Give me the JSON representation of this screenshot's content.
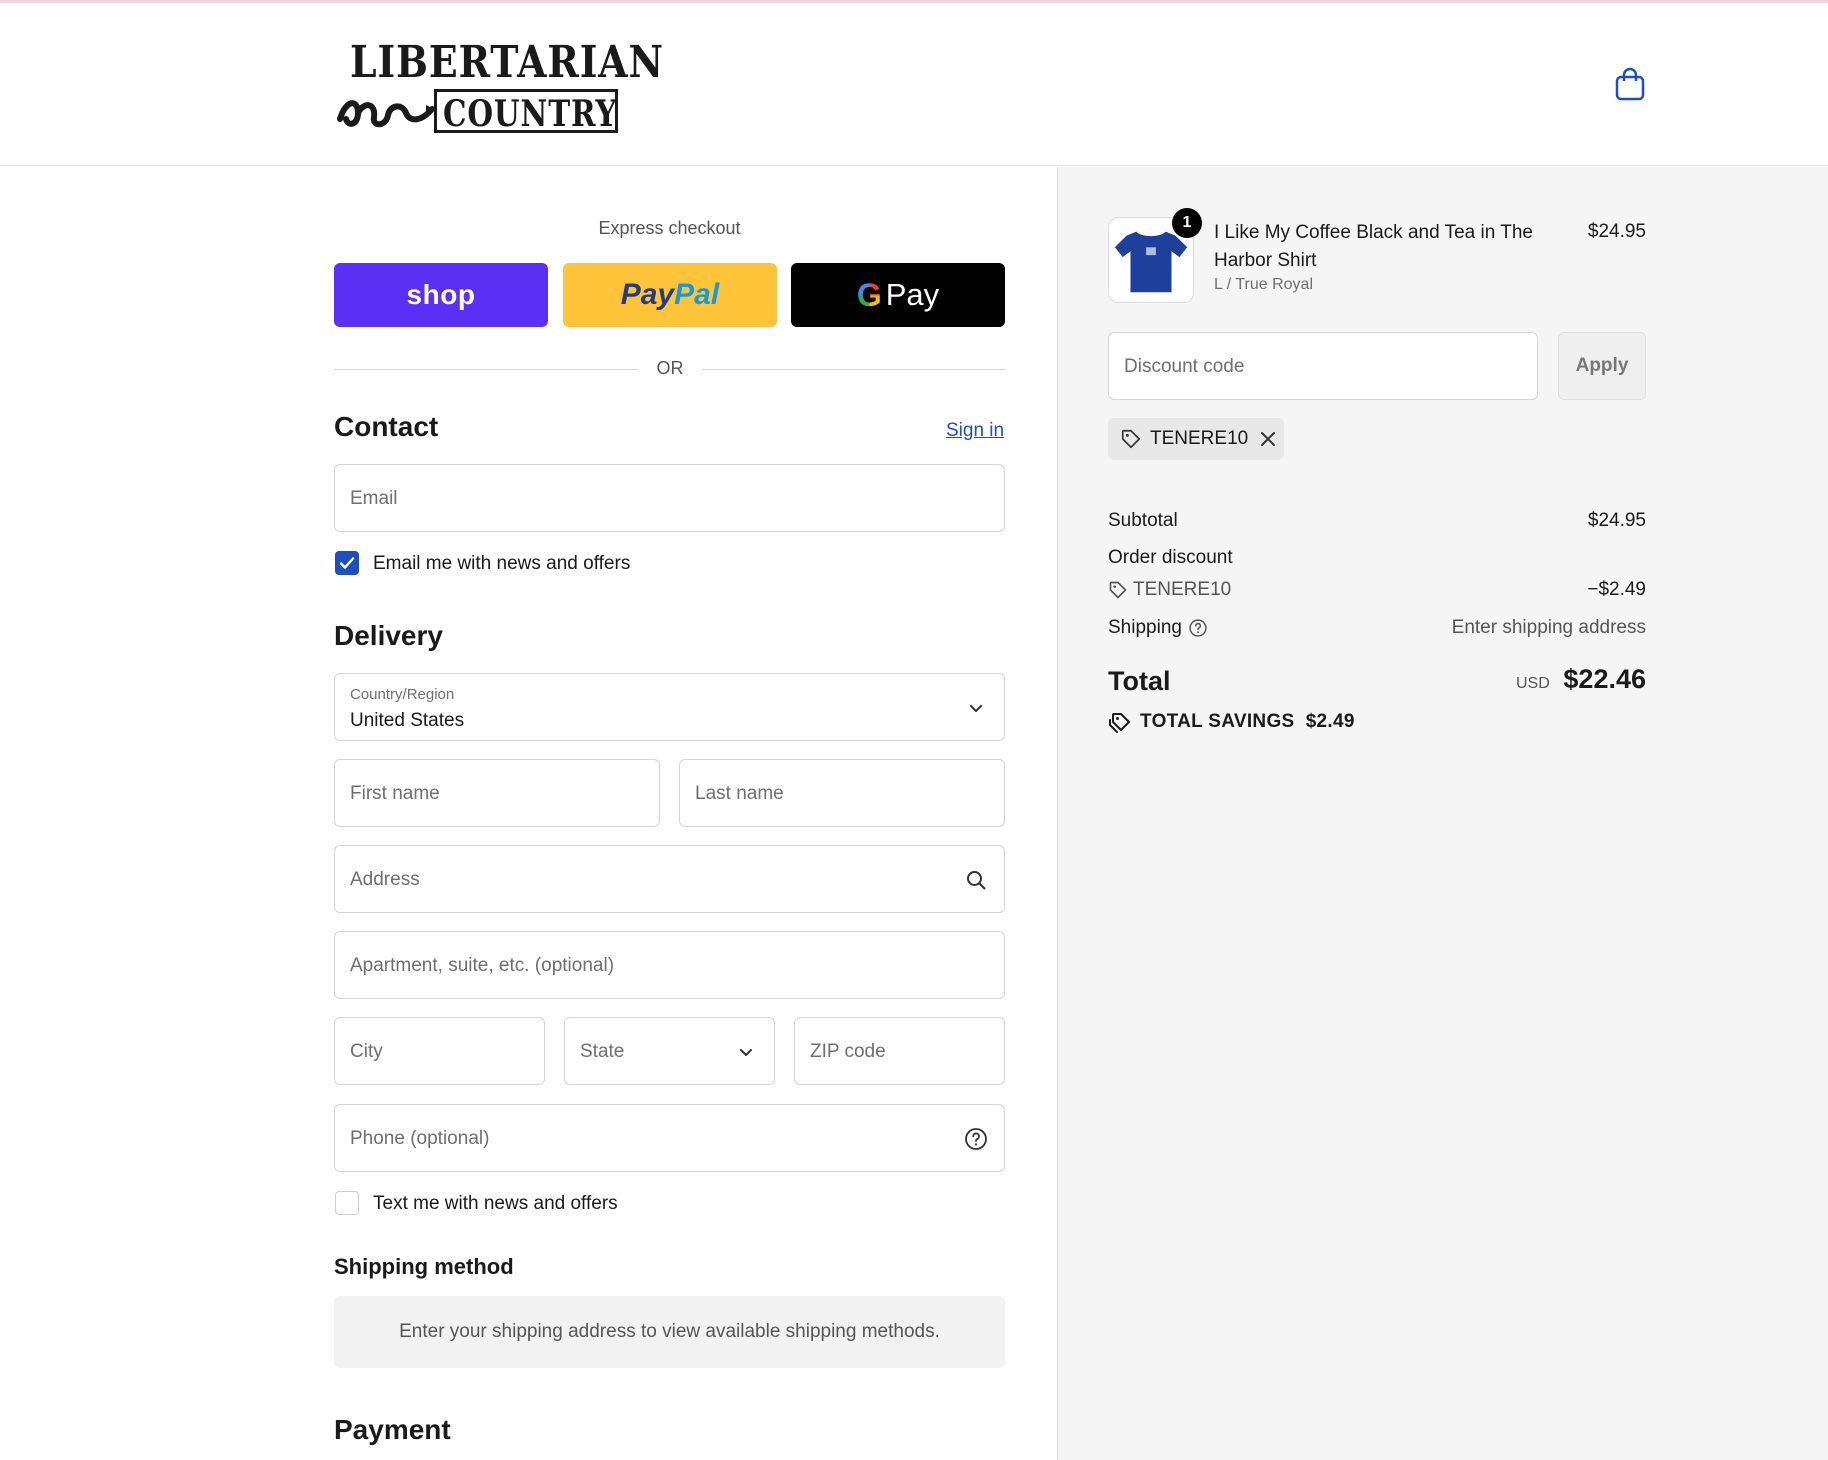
{
  "brand": {
    "line1": "LIBERTARIAN",
    "line2": "COUNTRY"
  },
  "express": {
    "title": "Express checkout",
    "shop_label": "shop",
    "paypal_label_1": "Pay",
    "paypal_label_2": "Pal",
    "gpay_g": "G",
    "gpay_label": "Pay",
    "or_label": "OR"
  },
  "contact": {
    "heading": "Contact",
    "sign_in": "Sign in",
    "email_placeholder": "Email",
    "news_label": "Email me with news and offers",
    "news_checked": true
  },
  "delivery": {
    "heading": "Delivery",
    "country_label": "Country/Region",
    "country_value": "United States",
    "first_name": "First name",
    "last_name": "Last name",
    "address": "Address",
    "apartment": "Apartment, suite, etc. (optional)",
    "city": "City",
    "state": "State",
    "zip": "ZIP code",
    "phone": "Phone (optional)",
    "text_label": "Text me with news and offers",
    "text_checked": false
  },
  "shipping_method": {
    "heading": "Shipping method",
    "info": "Enter your shipping address to view available shipping methods."
  },
  "payment": {
    "heading": "Payment"
  },
  "order": {
    "item": {
      "quantity": "1",
      "name": "I Like My Coffee Black and Tea in The Harbor Shirt",
      "variant": "L / True Royal",
      "price": "$24.95"
    },
    "discount_placeholder": "Discount code",
    "apply_label": "Apply",
    "applied_code": "TENERE10",
    "subtotal_label": "Subtotal",
    "subtotal_value": "$24.95",
    "order_discount_label": "Order discount",
    "discount_code": "TENERE10",
    "discount_value": "−$2.49",
    "shipping_label": "Shipping",
    "shipping_value": "Enter shipping address",
    "total_label": "Total",
    "currency": "USD",
    "total_value": "$22.46",
    "savings_label": "TOTAL SAVINGS",
    "savings_value": "$2.49"
  },
  "colors": {
    "accent": "#1f4fbf",
    "shop": "#5a31f4",
    "paypal": "#ffc439",
    "gpay": "#000000"
  }
}
